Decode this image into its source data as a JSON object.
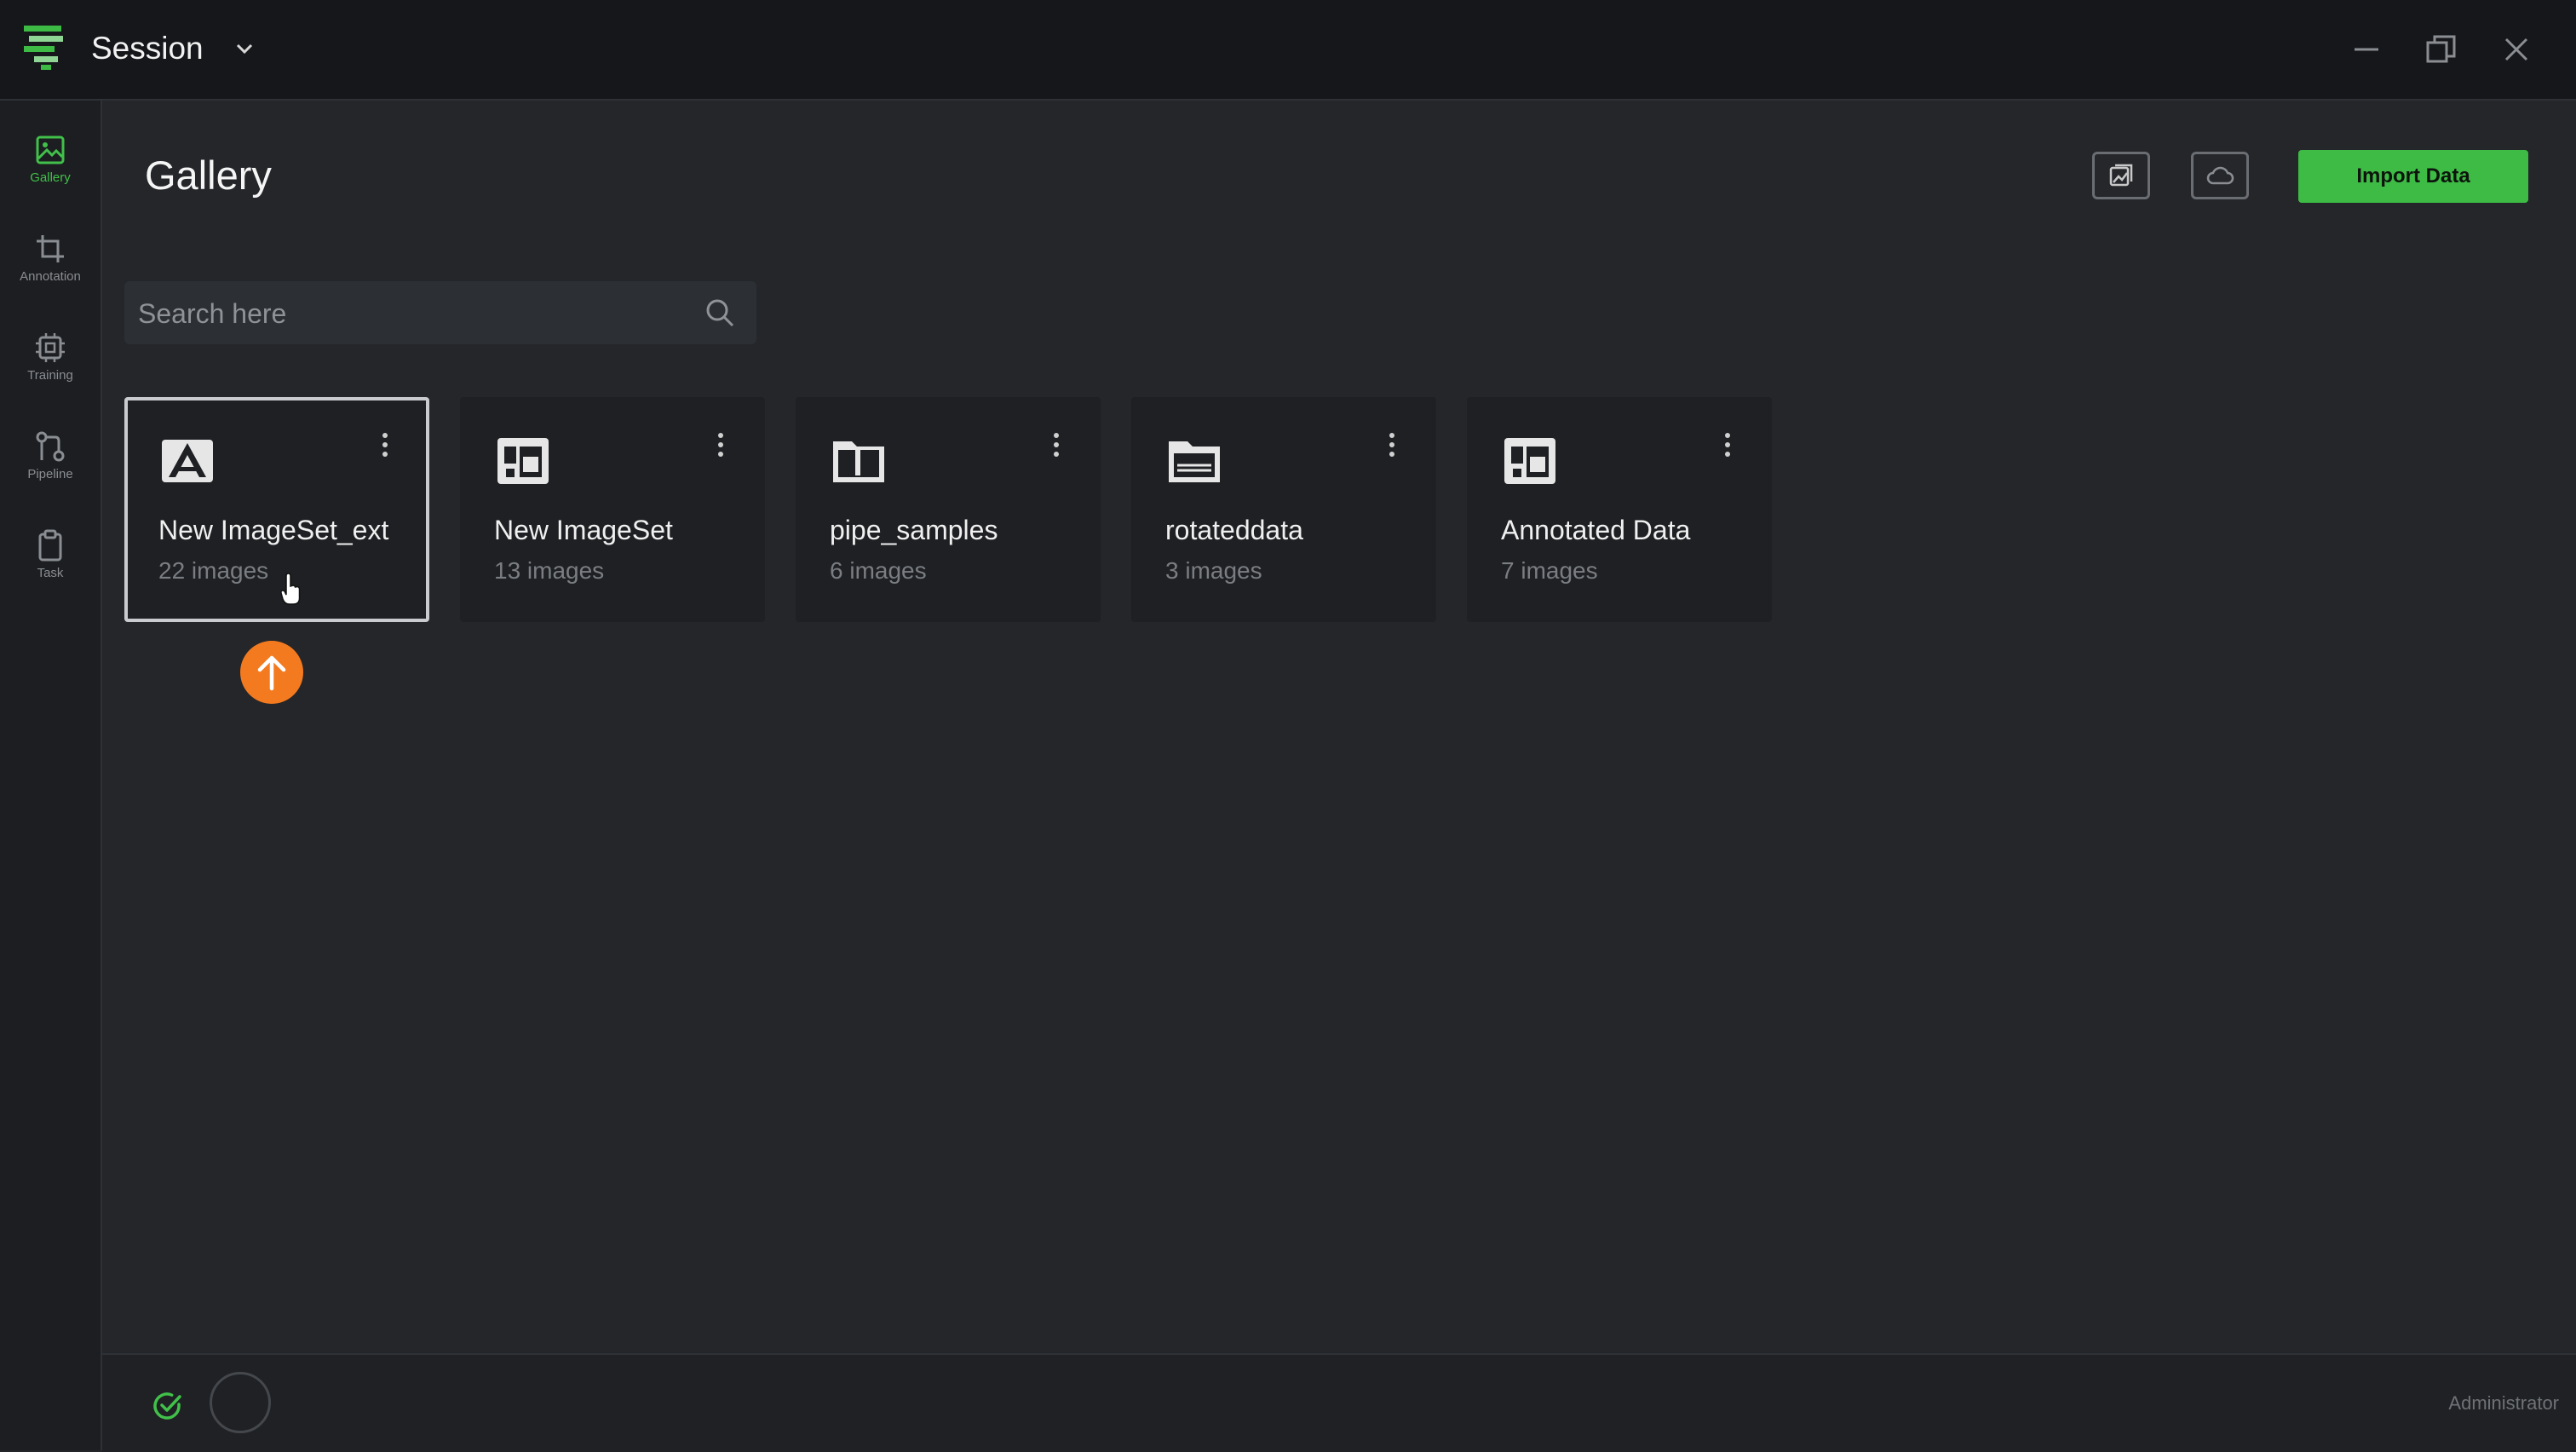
{
  "titlebar": {
    "title": "Session"
  },
  "sidebar": {
    "items": [
      {
        "label": "Gallery",
        "icon": "image-icon",
        "active": true
      },
      {
        "label": "Annotation",
        "icon": "crop-icon"
      },
      {
        "label": "Training",
        "icon": "chip-icon"
      },
      {
        "label": "Pipeline",
        "icon": "git-pull-icon"
      },
      {
        "label": "Task",
        "icon": "clipboard-icon"
      }
    ]
  },
  "header": {
    "title": "Gallery",
    "import_label": "Import Data"
  },
  "search": {
    "placeholder": "Search here",
    "value": ""
  },
  "cards": [
    {
      "name": "New ImageSet_ext",
      "count": "22 images",
      "icon": "annotated-set-icon"
    },
    {
      "name": "New ImageSet",
      "count": "13 images",
      "icon": "imageset-icon"
    },
    {
      "name": "pipe_samples",
      "count": "6 images",
      "icon": "folder-icon"
    },
    {
      "name": "rotateddata",
      "count": "3 images",
      "icon": "folder-open-icon"
    },
    {
      "name": "Annotated Data",
      "count": "7 images",
      "icon": "imageset-icon"
    }
  ],
  "statusbar": {
    "user": "Administrator"
  },
  "colors": {
    "accent": "#3dbb45",
    "upload": "#f47a1f",
    "background": "#24262a"
  }
}
